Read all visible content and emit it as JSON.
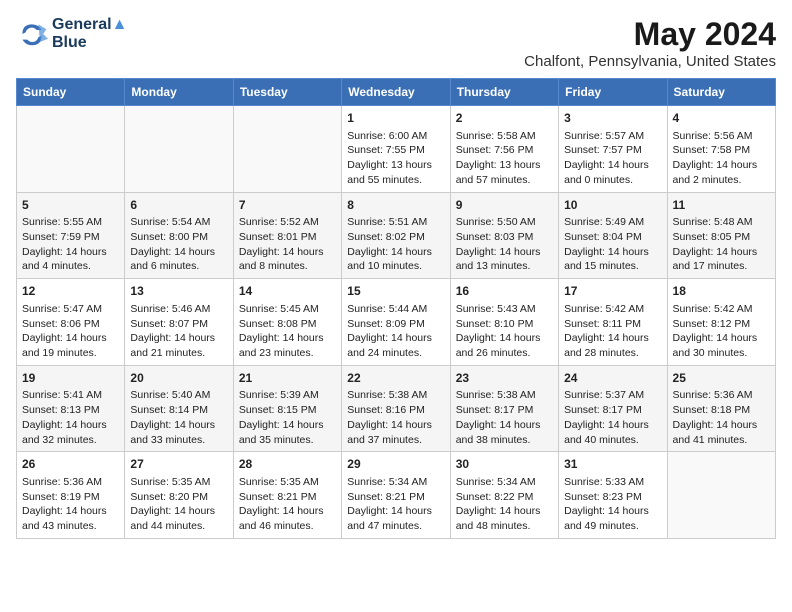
{
  "header": {
    "logo_line1": "General",
    "logo_line2": "Blue",
    "main_title": "May 2024",
    "subtitle": "Chalfont, Pennsylvania, United States"
  },
  "days_of_week": [
    "Sunday",
    "Monday",
    "Tuesday",
    "Wednesday",
    "Thursday",
    "Friday",
    "Saturday"
  ],
  "weeks": [
    [
      {
        "day": "",
        "content": ""
      },
      {
        "day": "",
        "content": ""
      },
      {
        "day": "",
        "content": ""
      },
      {
        "day": "1",
        "content": "Sunrise: 6:00 AM\nSunset: 7:55 PM\nDaylight: 13 hours\nand 55 minutes."
      },
      {
        "day": "2",
        "content": "Sunrise: 5:58 AM\nSunset: 7:56 PM\nDaylight: 13 hours\nand 57 minutes."
      },
      {
        "day": "3",
        "content": "Sunrise: 5:57 AM\nSunset: 7:57 PM\nDaylight: 14 hours\nand 0 minutes."
      },
      {
        "day": "4",
        "content": "Sunrise: 5:56 AM\nSunset: 7:58 PM\nDaylight: 14 hours\nand 2 minutes."
      }
    ],
    [
      {
        "day": "5",
        "content": "Sunrise: 5:55 AM\nSunset: 7:59 PM\nDaylight: 14 hours\nand 4 minutes."
      },
      {
        "day": "6",
        "content": "Sunrise: 5:54 AM\nSunset: 8:00 PM\nDaylight: 14 hours\nand 6 minutes."
      },
      {
        "day": "7",
        "content": "Sunrise: 5:52 AM\nSunset: 8:01 PM\nDaylight: 14 hours\nand 8 minutes."
      },
      {
        "day": "8",
        "content": "Sunrise: 5:51 AM\nSunset: 8:02 PM\nDaylight: 14 hours\nand 10 minutes."
      },
      {
        "day": "9",
        "content": "Sunrise: 5:50 AM\nSunset: 8:03 PM\nDaylight: 14 hours\nand 13 minutes."
      },
      {
        "day": "10",
        "content": "Sunrise: 5:49 AM\nSunset: 8:04 PM\nDaylight: 14 hours\nand 15 minutes."
      },
      {
        "day": "11",
        "content": "Sunrise: 5:48 AM\nSunset: 8:05 PM\nDaylight: 14 hours\nand 17 minutes."
      }
    ],
    [
      {
        "day": "12",
        "content": "Sunrise: 5:47 AM\nSunset: 8:06 PM\nDaylight: 14 hours\nand 19 minutes."
      },
      {
        "day": "13",
        "content": "Sunrise: 5:46 AM\nSunset: 8:07 PM\nDaylight: 14 hours\nand 21 minutes."
      },
      {
        "day": "14",
        "content": "Sunrise: 5:45 AM\nSunset: 8:08 PM\nDaylight: 14 hours\nand 23 minutes."
      },
      {
        "day": "15",
        "content": "Sunrise: 5:44 AM\nSunset: 8:09 PM\nDaylight: 14 hours\nand 24 minutes."
      },
      {
        "day": "16",
        "content": "Sunrise: 5:43 AM\nSunset: 8:10 PM\nDaylight: 14 hours\nand 26 minutes."
      },
      {
        "day": "17",
        "content": "Sunrise: 5:42 AM\nSunset: 8:11 PM\nDaylight: 14 hours\nand 28 minutes."
      },
      {
        "day": "18",
        "content": "Sunrise: 5:42 AM\nSunset: 8:12 PM\nDaylight: 14 hours\nand 30 minutes."
      }
    ],
    [
      {
        "day": "19",
        "content": "Sunrise: 5:41 AM\nSunset: 8:13 PM\nDaylight: 14 hours\nand 32 minutes."
      },
      {
        "day": "20",
        "content": "Sunrise: 5:40 AM\nSunset: 8:14 PM\nDaylight: 14 hours\nand 33 minutes."
      },
      {
        "day": "21",
        "content": "Sunrise: 5:39 AM\nSunset: 8:15 PM\nDaylight: 14 hours\nand 35 minutes."
      },
      {
        "day": "22",
        "content": "Sunrise: 5:38 AM\nSunset: 8:16 PM\nDaylight: 14 hours\nand 37 minutes."
      },
      {
        "day": "23",
        "content": "Sunrise: 5:38 AM\nSunset: 8:17 PM\nDaylight: 14 hours\nand 38 minutes."
      },
      {
        "day": "24",
        "content": "Sunrise: 5:37 AM\nSunset: 8:17 PM\nDaylight: 14 hours\nand 40 minutes."
      },
      {
        "day": "25",
        "content": "Sunrise: 5:36 AM\nSunset: 8:18 PM\nDaylight: 14 hours\nand 41 minutes."
      }
    ],
    [
      {
        "day": "26",
        "content": "Sunrise: 5:36 AM\nSunset: 8:19 PM\nDaylight: 14 hours\nand 43 minutes."
      },
      {
        "day": "27",
        "content": "Sunrise: 5:35 AM\nSunset: 8:20 PM\nDaylight: 14 hours\nand 44 minutes."
      },
      {
        "day": "28",
        "content": "Sunrise: 5:35 AM\nSunset: 8:21 PM\nDaylight: 14 hours\nand 46 minutes."
      },
      {
        "day": "29",
        "content": "Sunrise: 5:34 AM\nSunset: 8:21 PM\nDaylight: 14 hours\nand 47 minutes."
      },
      {
        "day": "30",
        "content": "Sunrise: 5:34 AM\nSunset: 8:22 PM\nDaylight: 14 hours\nand 48 minutes."
      },
      {
        "day": "31",
        "content": "Sunrise: 5:33 AM\nSunset: 8:23 PM\nDaylight: 14 hours\nand 49 minutes."
      },
      {
        "day": "",
        "content": ""
      }
    ]
  ]
}
